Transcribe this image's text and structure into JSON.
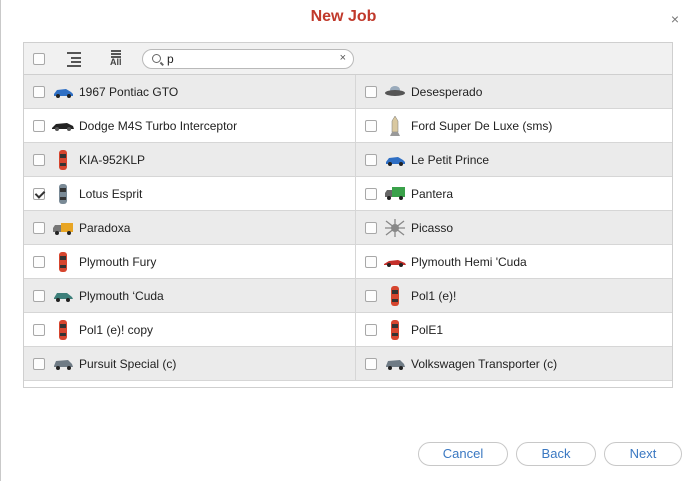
{
  "dialog": {
    "title": "New Job",
    "close_glyph": "×"
  },
  "toolbar": {
    "all_text": "All",
    "search_value": "p",
    "clear_glyph": "×"
  },
  "items": [
    {
      "label": "1967 Pontiac GTO",
      "icon": "blue-car-icon",
      "checked": false
    },
    {
      "label": "Desesperado",
      "icon": "ufo-icon",
      "checked": false
    },
    {
      "label": "Dodge M4S Turbo Interceptor",
      "icon": "black-car-icon",
      "checked": false
    },
    {
      "label": "Ford Super De Luxe (sms)",
      "icon": "rocket-icon",
      "checked": false
    },
    {
      "label": "KIA-952KLP",
      "icon": "red-car-icon",
      "checked": false
    },
    {
      "label": "Le Petit Prince",
      "icon": "blue-car-icon",
      "checked": false
    },
    {
      "label": "Lotus Esprit",
      "icon": "gray-car-icon",
      "checked": true
    },
    {
      "label": "Pantera",
      "icon": "green-truck-icon",
      "checked": false
    },
    {
      "label": "Paradoxa",
      "icon": "yellow-truck-icon",
      "checked": false
    },
    {
      "label": "Picasso",
      "icon": "spider-icon",
      "checked": false
    },
    {
      "label": "Plymouth Fury",
      "icon": "red-car-icon",
      "checked": false
    },
    {
      "label": "Plymouth Hemi 'Cuda",
      "icon": "red-sports-car-icon",
      "checked": false
    },
    {
      "label": "Plymouth ‘Cuda",
      "icon": "teal-car-icon",
      "checked": false
    },
    {
      "label": "Pol1 (e)!",
      "icon": "red-car-icon",
      "checked": false
    },
    {
      "label": "Pol1 (e)! copy",
      "icon": "red-car-icon",
      "checked": false
    },
    {
      "label": "PolE1",
      "icon": "red-car-icon",
      "checked": false
    },
    {
      "label": "Pursuit Special (c)",
      "icon": "gray-sedan-icon",
      "checked": false
    },
    {
      "label": "Volkswagen Transporter (c)",
      "icon": "gray-sedan-icon",
      "checked": false
    }
  ],
  "buttons": {
    "cancel": "Cancel",
    "back": "Back",
    "next": "Next"
  },
  "colors": {
    "title": "#c0392b",
    "button_text": "#3a78c2",
    "row_shade": "#ebebeb"
  }
}
